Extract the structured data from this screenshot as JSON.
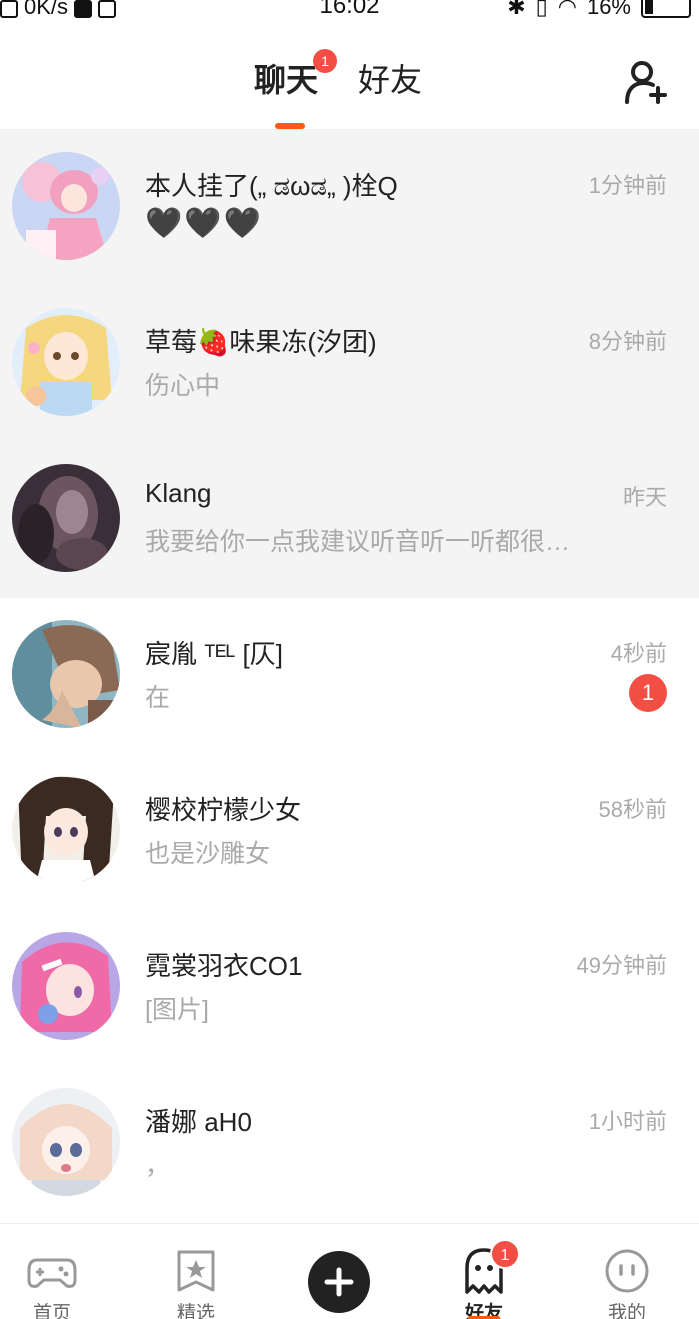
{
  "status_bar": {
    "speed": "0K/s",
    "time": "16:02",
    "battery": "16%"
  },
  "header": {
    "tabs": [
      {
        "label": "聊天",
        "active": true,
        "badge": "1"
      },
      {
        "label": "好友",
        "active": false
      }
    ],
    "add_friend_icon": "add-user-icon"
  },
  "chats": [
    {
      "name": "本人挂了(„ ಡωಡ„ )栓Q",
      "time": "1分钟前",
      "preview": "🖤🖤🖤",
      "pinned": true,
      "avatar": "pink-anime-girl"
    },
    {
      "name": "草莓🍓味果冻(汐团)",
      "time": "8分钟前",
      "preview": "伤心中",
      "pinned": true,
      "avatar": "blonde-anime-girl"
    },
    {
      "name": "Klang",
      "time": "昨天",
      "preview": "我要给你一点我建议听音听一听都很…",
      "pinned": true,
      "avatar": "blurred-photo"
    },
    {
      "name": "宸胤 ᵀᴱᴸ [仄]",
      "time": "4秒前",
      "preview": "在",
      "unread": "1",
      "pinned": false,
      "avatar": "brown-hair-boy"
    },
    {
      "name": "樱校柠檬少女",
      "time": "58秒前",
      "preview": "也是沙雕女",
      "pinned": false,
      "avatar": "dark-hair-girl"
    },
    {
      "name": "霓裳羽衣CO1",
      "time": "49分钟前",
      "preview": "[图片]",
      "pinned": false,
      "avatar": "pink-hair-girl"
    },
    {
      "name": "潘娜 aH0",
      "time": "1小时前",
      "preview": "，",
      "pinned": false,
      "avatar": "light-hair-girl"
    }
  ],
  "bottom_nav": {
    "items": [
      {
        "label": "首页",
        "icon": "gamepad-icon"
      },
      {
        "label": "精选",
        "icon": "star-bookmark-icon"
      },
      {
        "label": "",
        "icon": "plus-icon"
      },
      {
        "label": "好友",
        "icon": "ghost-icon",
        "active": true,
        "badge": "1"
      },
      {
        "label": "我的",
        "icon": "face-icon"
      }
    ]
  },
  "colors": {
    "accent": "#ff5a12",
    "badge": "#f24e43",
    "pinned_bg": "#f4f4f4"
  }
}
